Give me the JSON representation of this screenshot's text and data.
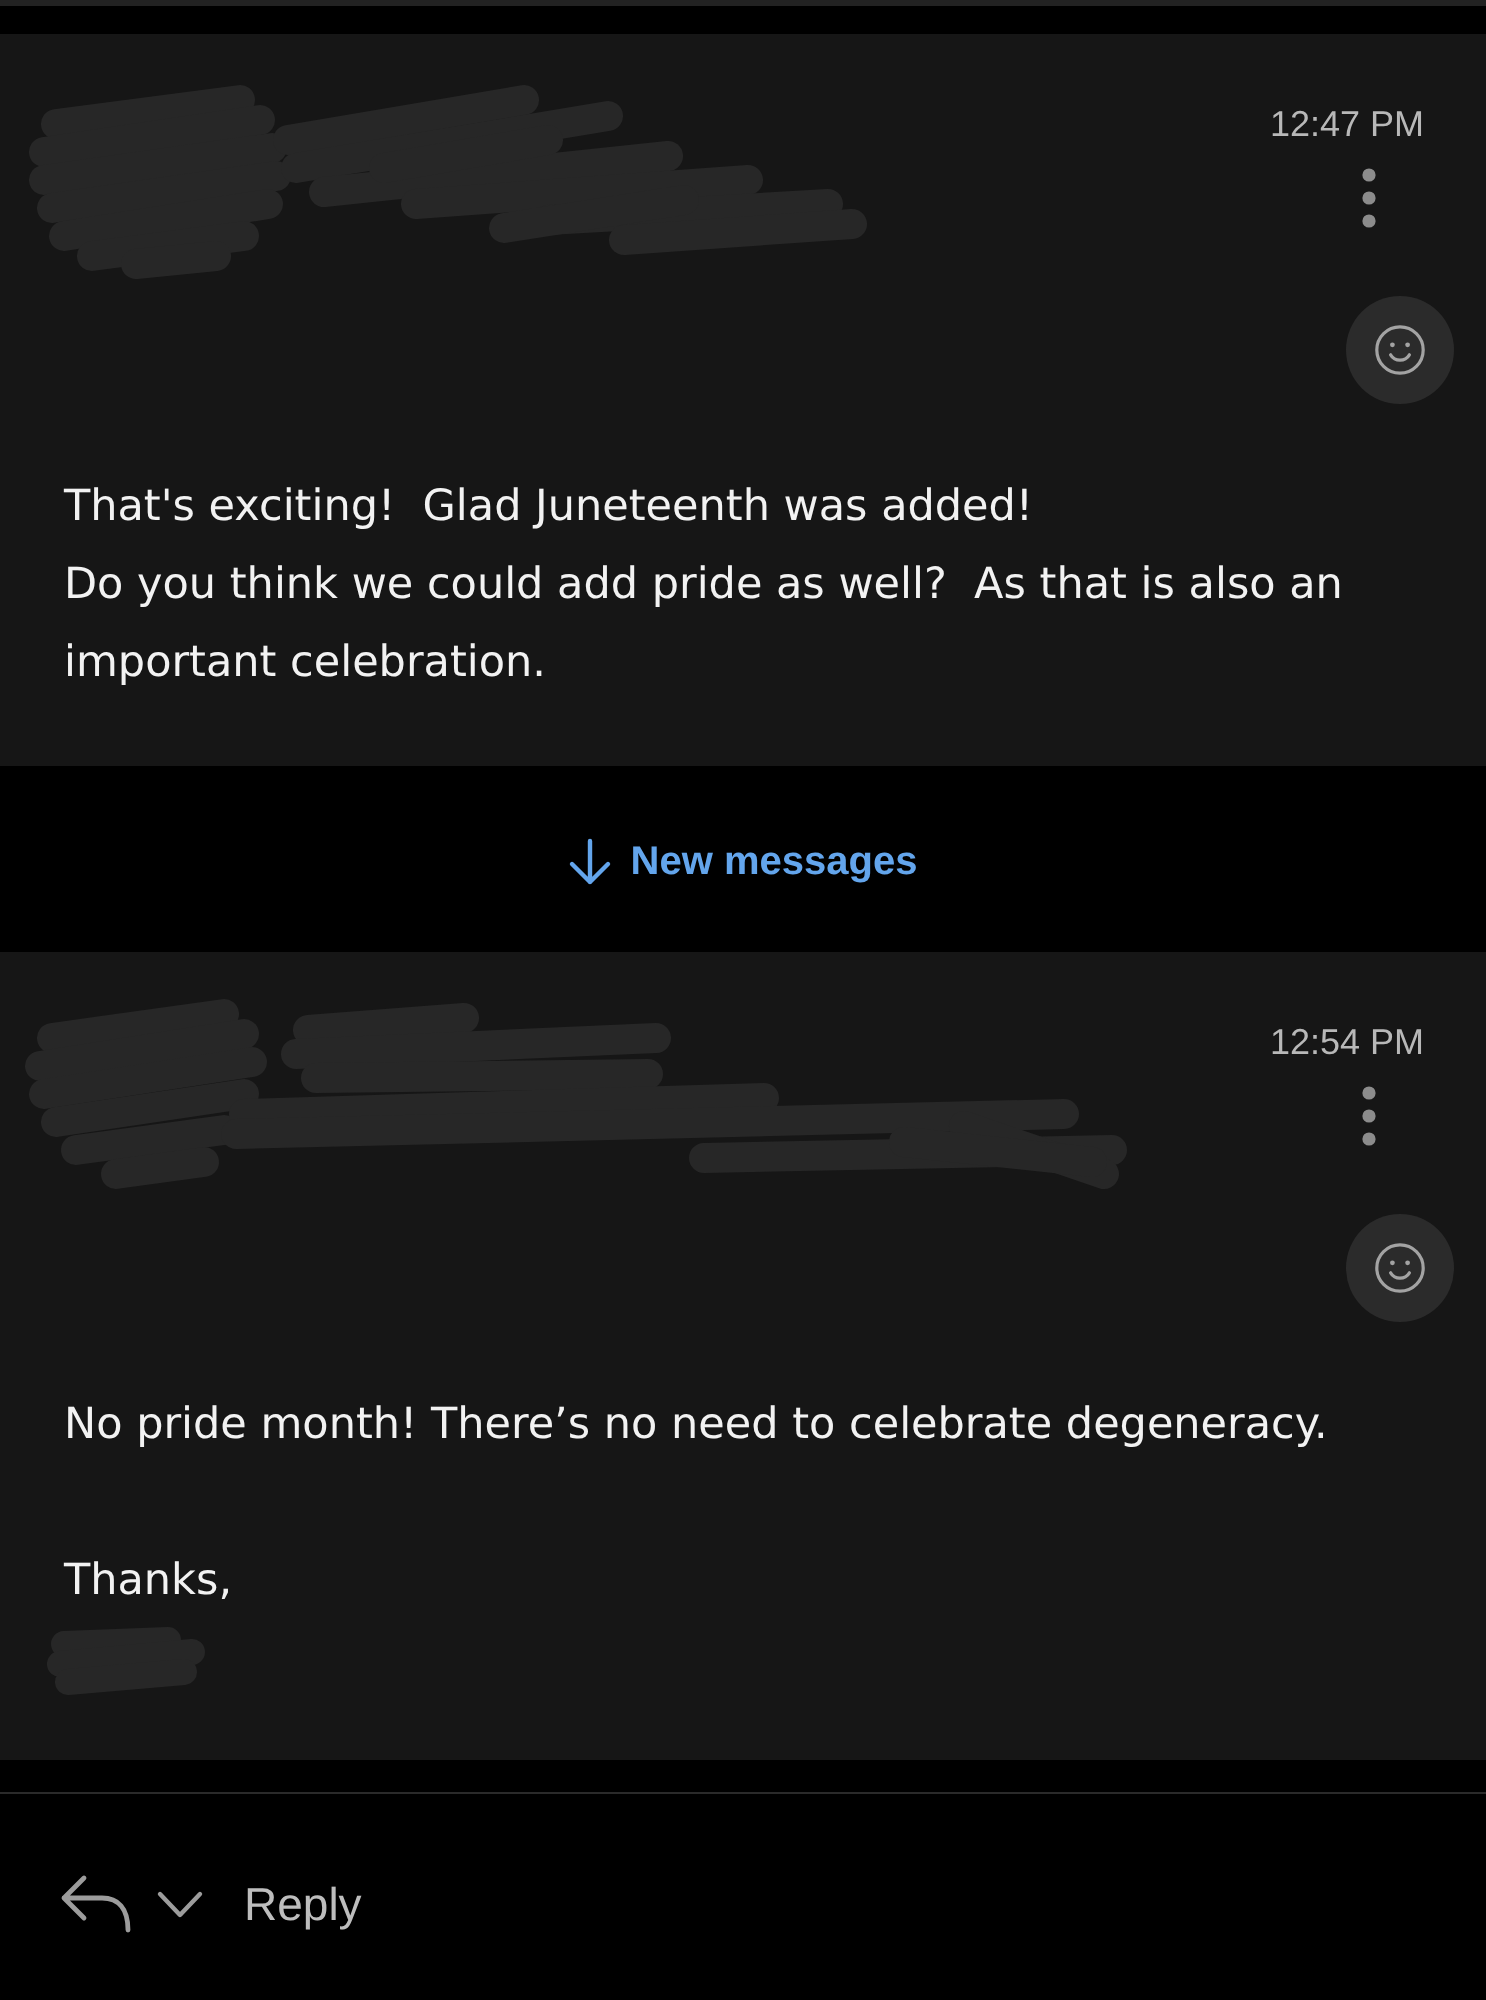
{
  "thread": [
    {
      "kind": "message",
      "time": "12:47 PM",
      "paragraphs": [
        "That's exciting!  Glad Juneteenth was added!\nDo you think we could add pride as well?  As that is also an important celebration."
      ],
      "signature_redacted": false
    },
    {
      "kind": "divider",
      "label": "New messages"
    },
    {
      "kind": "message",
      "time": "12:54 PM",
      "paragraphs": [
        "No pride month! There’s no need to celebrate degeneracy.",
        "Thanks,"
      ],
      "signature_redacted": true
    }
  ],
  "reply_bar": {
    "label": "Reply"
  }
}
